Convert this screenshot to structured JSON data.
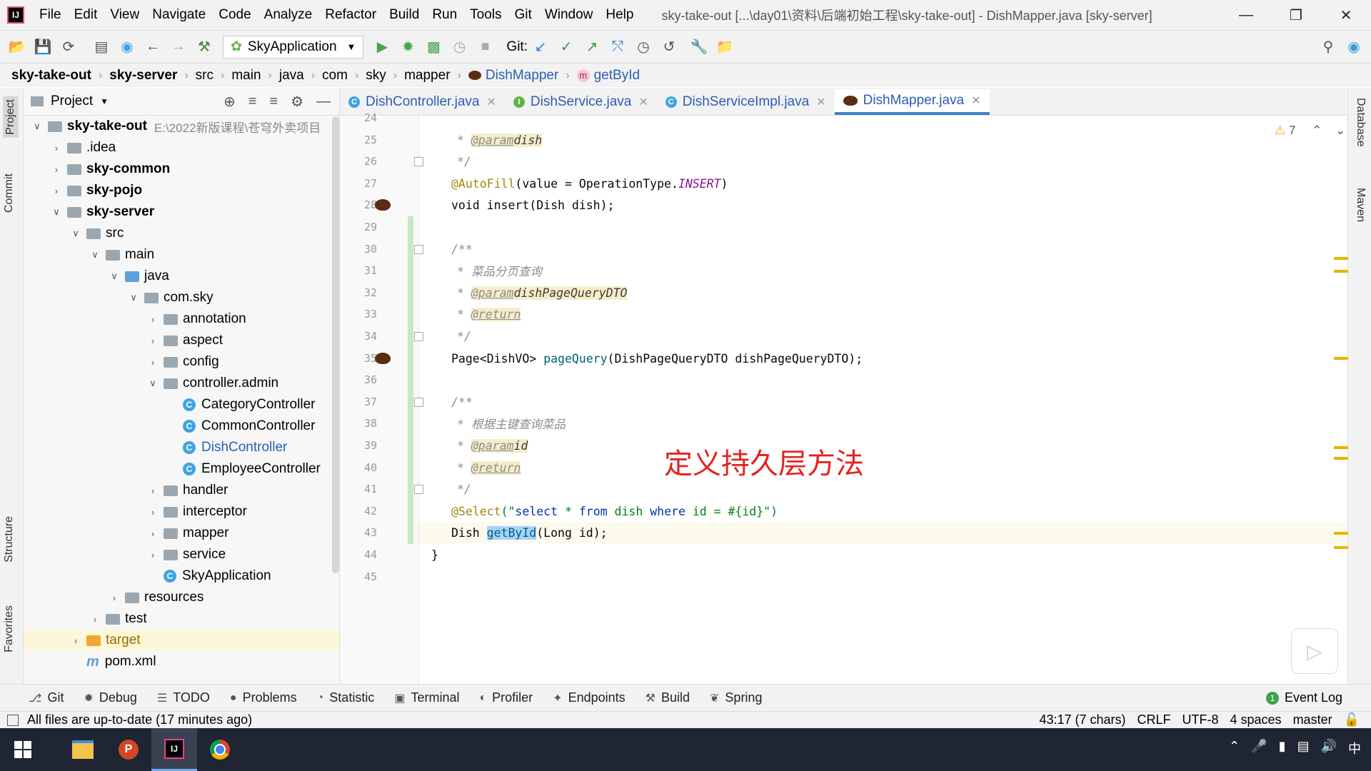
{
  "window": {
    "title": "sky-take-out [...\\day01\\资料\\后端初始工程\\sky-take-out] - DishMapper.java [sky-server]",
    "logo": "IJ"
  },
  "menu": [
    "File",
    "Edit",
    "View",
    "Navigate",
    "Code",
    "Analyze",
    "Refactor",
    "Build",
    "Run",
    "Tools",
    "Git",
    "Window",
    "Help"
  ],
  "toolbar": {
    "run_config": "SkyApplication",
    "git_label": "Git:"
  },
  "breadcrumb": [
    "sky-take-out",
    "sky-server",
    "src",
    "main",
    "java",
    "com",
    "sky",
    "mapper",
    "DishMapper",
    "getById"
  ],
  "left_tabs": [
    "Project",
    "Commit",
    "Structure",
    "Favorites"
  ],
  "project": {
    "header": "Project",
    "tree": [
      {
        "label": "sky-take-out",
        "indent": 0,
        "arrow": "v",
        "icon": "module",
        "bold": true,
        "hint": "E:\\2022新版课程\\苍穹外卖项目"
      },
      {
        "label": ".idea",
        "indent": 1,
        "arrow": ">",
        "icon": "folder"
      },
      {
        "label": "sky-common",
        "indent": 1,
        "arrow": ">",
        "icon": "module",
        "bold": true
      },
      {
        "label": "sky-pojo",
        "indent": 1,
        "arrow": ">",
        "icon": "module",
        "bold": true
      },
      {
        "label": "sky-server",
        "indent": 1,
        "arrow": "v",
        "icon": "module",
        "bold": true
      },
      {
        "label": "src",
        "indent": 2,
        "arrow": "v",
        "icon": "folder"
      },
      {
        "label": "main",
        "indent": 3,
        "arrow": "v",
        "icon": "folder"
      },
      {
        "label": "java",
        "indent": 4,
        "arrow": "v",
        "icon": "folder-blue"
      },
      {
        "label": "com.sky",
        "indent": 5,
        "arrow": "v",
        "icon": "folder"
      },
      {
        "label": "annotation",
        "indent": 6,
        "arrow": ">",
        "icon": "folder"
      },
      {
        "label": "aspect",
        "indent": 6,
        "arrow": ">",
        "icon": "folder"
      },
      {
        "label": "config",
        "indent": 6,
        "arrow": ">",
        "icon": "folder"
      },
      {
        "label": "controller.admin",
        "indent": 6,
        "arrow": "v",
        "icon": "folder"
      },
      {
        "label": "CategoryController",
        "indent": 7,
        "arrow": "",
        "icon": "class"
      },
      {
        "label": "CommonController",
        "indent": 7,
        "arrow": "",
        "icon": "class"
      },
      {
        "label": "DishController",
        "indent": 7,
        "arrow": "",
        "icon": "class",
        "link": true
      },
      {
        "label": "EmployeeController",
        "indent": 7,
        "arrow": "",
        "icon": "class"
      },
      {
        "label": "handler",
        "indent": 6,
        "arrow": ">",
        "icon": "folder"
      },
      {
        "label": "interceptor",
        "indent": 6,
        "arrow": ">",
        "icon": "folder"
      },
      {
        "label": "mapper",
        "indent": 6,
        "arrow": ">",
        "icon": "folder"
      },
      {
        "label": "service",
        "indent": 6,
        "arrow": ">",
        "icon": "folder"
      },
      {
        "label": "SkyApplication",
        "indent": 6,
        "arrow": "",
        "icon": "class"
      },
      {
        "label": "resources",
        "indent": 4,
        "arrow": ">",
        "icon": "folder"
      },
      {
        "label": "test",
        "indent": 3,
        "arrow": ">",
        "icon": "folder"
      },
      {
        "label": "target",
        "indent": 2,
        "arrow": ">",
        "icon": "folder-orange",
        "highlight": true
      },
      {
        "label": "pom.xml",
        "indent": 2,
        "arrow": "",
        "icon": "maven"
      }
    ]
  },
  "tabs": [
    {
      "label": "DishController.java",
      "icon": "C",
      "color": "#3fa5e0"
    },
    {
      "label": "DishService.java",
      "icon": "I",
      "color": "#62b543"
    },
    {
      "label": "DishServiceImpl.java",
      "icon": "C",
      "color": "#3fa5e0"
    },
    {
      "label": "DishMapper.java",
      "icon": "bean",
      "color": "#5a2d14",
      "active": true
    }
  ],
  "editor": {
    "warning_count": "7",
    "line_numbers": [
      "24",
      "25",
      "26",
      "27",
      "28",
      "29",
      "30",
      "31",
      "32",
      "33",
      "34",
      "35",
      "36",
      "37",
      "38",
      "39",
      "40",
      "41",
      "42",
      "43",
      "44",
      "45"
    ],
    "code": {
      "l25_tag": "@param",
      "l25_ref": "dish",
      "l27_ann": "@AutoFill",
      "l27_rest": "(value = OperationType.",
      "l27_const": "INSERT",
      "l27_close": ")",
      "l28": "void insert(Dish dish);",
      "l30": "/**",
      "l31": "* 菜品分页查询",
      "l32_tag": "@param",
      "l32_ref": "dishPageQueryDTO",
      "l33_tag": "@return",
      "l34": "*/",
      "l35_pre": "Page<DishVO> ",
      "l35_fn": "pageQuery",
      "l35_rest": "(DishPageQueryDTO dishPageQueryDTO);",
      "l37": "/**",
      "l38": "* 根据主键查询菜品",
      "l39_tag": "@param",
      "l39_ref": "id",
      "l40_tag": "@return",
      "l41": "*/",
      "l42_ann": "@Select",
      "l42_open": "(\"",
      "l42_kw1": "select",
      "l42_mid1": " * ",
      "l42_kw2": "from",
      "l42_mid2": " dish ",
      "l42_kw3": "where",
      "l42_mid3": " id = #{id}",
      "l42_close": "\")",
      "l43_pre": "Dish ",
      "l43_sel": "getById",
      "l43_rest": "(Long id);",
      "l44": "}",
      "l26": "*/"
    },
    "overlay": "定义持久层方法"
  },
  "right_tabs": [
    "Database",
    "Maven"
  ],
  "tool_windows": [
    "Git",
    "Debug",
    "TODO",
    "Problems",
    "Statistic",
    "Terminal",
    "Profiler",
    "Endpoints",
    "Build",
    "Spring"
  ],
  "event_log": "Event Log",
  "event_count": "1",
  "status": {
    "message": "All files are up-to-date (17 minutes ago)",
    "position": "43:17 (7 chars)",
    "line_sep": "CRLF",
    "encoding": "UTF-8",
    "indent": "4 spaces",
    "branch": "master"
  },
  "taskbar": {
    "tray": [
      "中"
    ]
  },
  "colors": {
    "accent": "#4083c9",
    "overlay": "#e5221f",
    "selection": "#a6d2ff"
  }
}
